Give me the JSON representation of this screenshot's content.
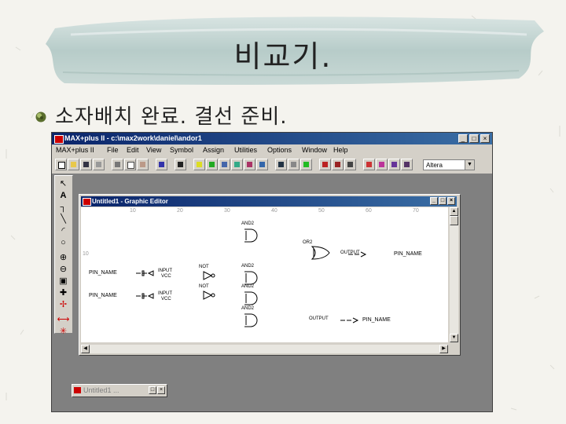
{
  "slide": {
    "title": "비교기.",
    "bullet": "소자배치 완료. 결선 준비."
  },
  "app": {
    "title": "MAX+plus II - c:\\max2work\\daniel\\andor1",
    "window_buttons": [
      "_",
      "□",
      "×"
    ],
    "menu": [
      "MAX+plus II",
      "File",
      "Edit",
      "View",
      "Symbol",
      "Assign",
      "Utilities",
      "Options",
      "Window",
      "Help"
    ],
    "device_family": "Altera",
    "palette_tools": [
      "selection-arrow",
      "text-tool",
      "orthogonal-line",
      "diagonal-line",
      "arc-tool",
      "circle-tool",
      "zoom-in",
      "zoom-out",
      "fit-in-window",
      "rubberband-on",
      "rubberband-off",
      "connect-dots",
      "cross-connect"
    ]
  },
  "graphic_editor": {
    "title": "Untitled1 - Graphic Editor",
    "ruler_marks": [
      "10",
      "20",
      "30",
      "40",
      "50",
      "60",
      "70"
    ],
    "row_mark": "10",
    "inputs": [
      {
        "pin_name": "PIN_NAME",
        "type": "INPUT",
        "default": "VCC"
      },
      {
        "pin_name": "PIN_NAME",
        "type": "INPUT",
        "default": "VCC"
      }
    ],
    "nots": [
      {
        "label": "NOT"
      },
      {
        "label": "NOT"
      }
    ],
    "ands": [
      {
        "label": "AND2"
      },
      {
        "label": "AND2"
      },
      {
        "label": "AND2"
      },
      {
        "label": "AND2"
      }
    ],
    "or": {
      "label": "OR2"
    },
    "outputs": [
      {
        "type": "OUTPUT",
        "pin_name": "PIN_NAME"
      },
      {
        "type": "OUTPUT",
        "pin_name": "PIN_NAME"
      }
    ]
  },
  "minimized_window": {
    "title": "Untitled1 ..."
  }
}
